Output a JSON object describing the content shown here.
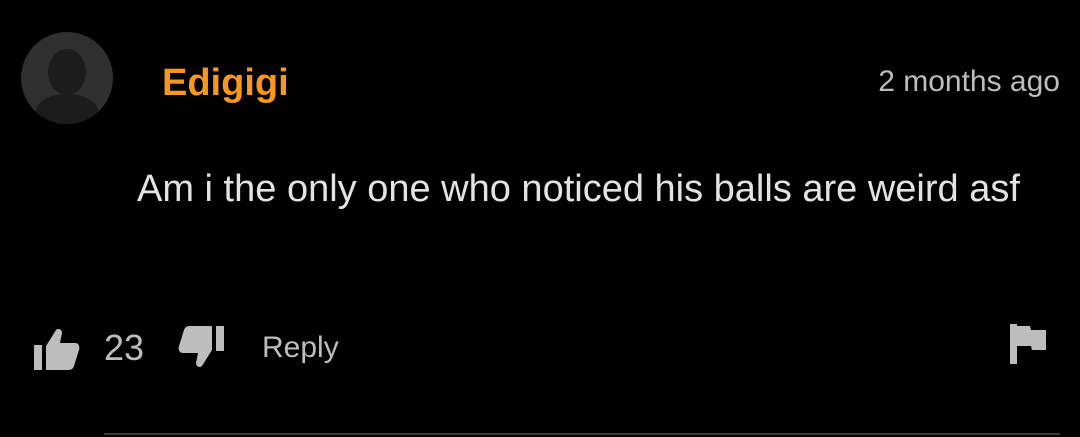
{
  "comment": {
    "username": "Edigigi",
    "timestamp": "2 months ago",
    "text": "Am i the only one who noticed his balls are weird asf",
    "likes": "23",
    "reply_label": "Reply"
  },
  "icons": {
    "avatar": "user-silhouette-icon",
    "like": "thumbs-up-icon",
    "dislike": "thumbs-down-icon",
    "flag": "flag-icon"
  },
  "colors": {
    "background": "#000000",
    "username": "#f7971d",
    "text": "#e3e3e3",
    "muted": "#bdbdbd",
    "avatar_bg": "#2f2f2f"
  }
}
